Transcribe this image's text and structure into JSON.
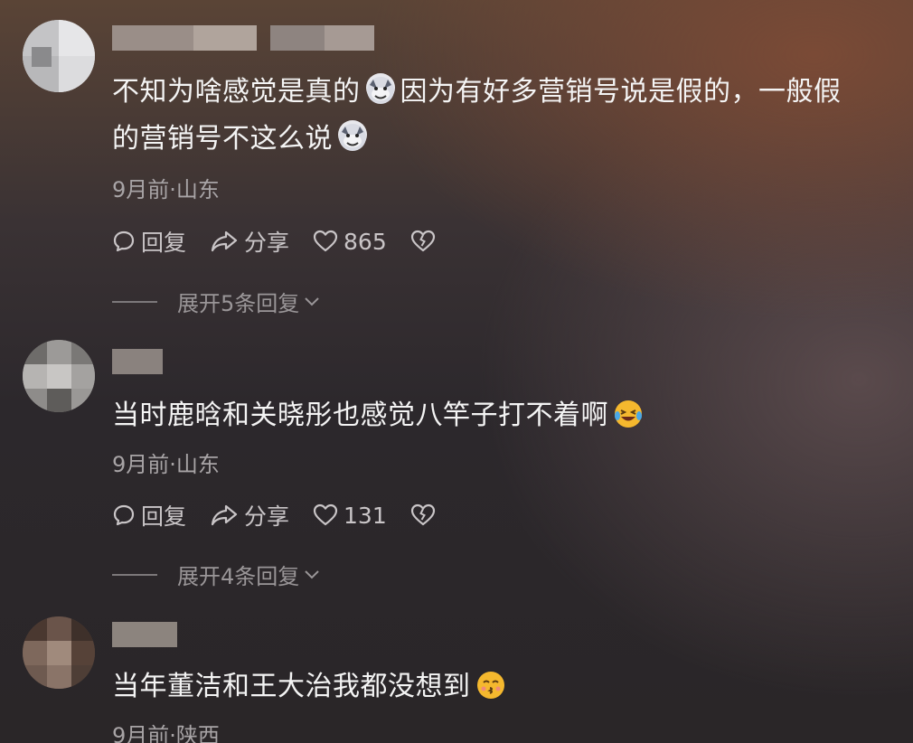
{
  "comments": [
    {
      "text_parts": [
        "不知为啥感觉是真的",
        "因为有好多营销号说是假的，一般假",
        "的营销号不这么说"
      ],
      "meta": "9月前·山东",
      "reply_label": "回复",
      "share_label": "分享",
      "likes": "865",
      "expand_label": "展开5条回复",
      "emoji": "wolf-face-emoji"
    },
    {
      "text": "当时鹿晗和关晓彤也感觉八竿子打不着啊",
      "meta": "9月前·山东",
      "reply_label": "回复",
      "share_label": "分享",
      "likes": "131",
      "expand_label": "展开4条回复",
      "emoji": "laughing-crying-emoji"
    },
    {
      "text": "当年董洁和王大治我都没想到",
      "meta": "9月前·陕西",
      "emoji": "kissing-emoji"
    }
  ],
  "colors": {
    "text": "#f4f4f4",
    "meta": "#a8a4a6",
    "action": "#c9c5c7"
  }
}
